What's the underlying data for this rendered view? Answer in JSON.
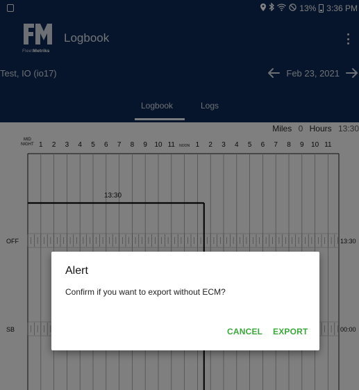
{
  "status_bar": {
    "battery": "13%",
    "time": "3:36 PM",
    "icons": [
      "location-icon",
      "bluetooth-icon",
      "wifi-icon",
      "do-not-disturb-icon",
      "battery-icon"
    ]
  },
  "app": {
    "logo_caption_prefix": "Fleet",
    "logo_caption_bold": "Metriks",
    "title": "Logbook",
    "driver": "Test, IO (io17)",
    "date": "Feb 23, 2021"
  },
  "tabs": [
    {
      "label": "Logbook",
      "selected": true
    },
    {
      "label": "Logs",
      "selected": false
    }
  ],
  "summary": {
    "miles_label": "Miles",
    "miles_value": "0",
    "hours_label": "Hours",
    "hours_value": "13:30"
  },
  "grid": {
    "midnight_line1": "MID",
    "midnight_line2": "NIGHT",
    "noon_label": "NOON",
    "hour_labels": [
      "1",
      "2",
      "3",
      "4",
      "5",
      "6",
      "7",
      "8",
      "9",
      "10",
      "11",
      "1",
      "2",
      "3",
      "4",
      "5",
      "6",
      "7",
      "8",
      "9",
      "10",
      "11"
    ],
    "rows": [
      {
        "label": "OFF",
        "total": "13:30"
      },
      {
        "label": "SB",
        "total": "00:00"
      }
    ],
    "segment_label": "13:30"
  },
  "dialog": {
    "title": "Alert",
    "message": "Confirm if you want to export without ECM?",
    "cancel_label": "CANCEL",
    "export_label": "EXPORT"
  },
  "colors": {
    "header": "#0f2a55",
    "accent_button": "#3aa83a"
  }
}
